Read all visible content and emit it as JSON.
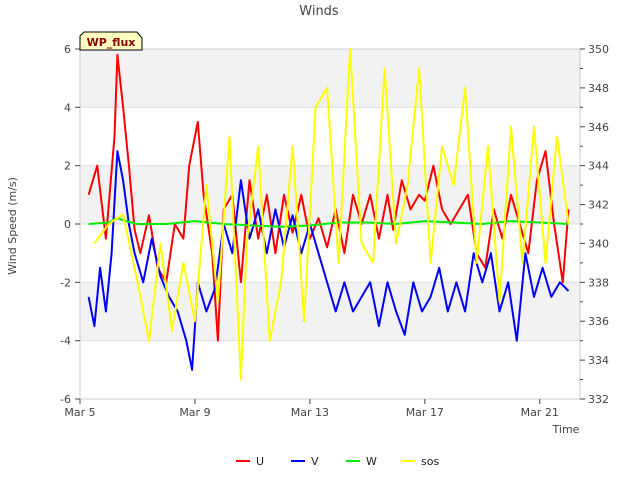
{
  "chart_data": {
    "type": "line",
    "title": "Winds",
    "xlabel": "Time",
    "ylabel": "Wind Speed (m/s)",
    "y2label": "",
    "badge": "WP_flux",
    "xlim": [
      0,
      17.4
    ],
    "ylim": [
      -6,
      6
    ],
    "y2lim": [
      332,
      350
    ],
    "x_ticks": [
      {
        "x": 0,
        "label": "Mar 5"
      },
      {
        "x": 4,
        "label": "Mar 9"
      },
      {
        "x": 8,
        "label": "Mar 13"
      },
      {
        "x": 12,
        "label": "Mar 17"
      },
      {
        "x": 16,
        "label": "Mar 21"
      }
    ],
    "y_ticks": [
      -6,
      -4,
      -2,
      0,
      2,
      4,
      6
    ],
    "y2_ticks": [
      332,
      334,
      336,
      338,
      340,
      342,
      344,
      346,
      348,
      350
    ],
    "bands": [
      [
        4,
        6
      ],
      [
        0,
        2
      ],
      [
        -4,
        -2
      ]
    ],
    "grid": true,
    "legend_position": "bottom",
    "series": [
      {
        "name": "U",
        "color": "#ff0000",
        "axis": "left",
        "x": [
          0.3,
          0.6,
          0.9,
          1.2,
          1.3,
          1.5,
          1.7,
          1.9,
          2.1,
          2.4,
          2.7,
          3.0,
          3.3,
          3.6,
          3.8,
          4.1,
          4.3,
          4.6,
          4.8,
          5.0,
          5.3,
          5.6,
          5.9,
          6.2,
          6.5,
          6.8,
          7.1,
          7.4,
          7.7,
          8.0,
          8.3,
          8.6,
          8.9,
          9.2,
          9.5,
          9.8,
          10.1,
          10.4,
          10.7,
          10.9,
          11.2,
          11.5,
          11.8,
          12.0,
          12.3,
          12.6,
          12.9,
          13.2,
          13.5,
          13.8,
          14.1,
          14.4,
          14.7,
          15.0,
          15.3,
          15.6,
          15.9,
          16.2,
          16.5,
          16.8,
          17.0
        ],
        "y": [
          1.0,
          2.0,
          -0.5,
          3.0,
          5.8,
          4.0,
          2.0,
          -0.2,
          -1.0,
          0.3,
          -1.5,
          -2.0,
          0.0,
          -0.5,
          2.0,
          3.5,
          1.0,
          -1.0,
          -4.0,
          0.5,
          1.0,
          -2.0,
          1.5,
          -0.5,
          1.0,
          -1.0,
          1.0,
          -0.3,
          1.0,
          -0.5,
          0.2,
          -0.8,
          0.5,
          -1.0,
          1.0,
          0.0,
          1.0,
          -0.5,
          1.0,
          -0.2,
          1.5,
          0.5,
          1.0,
          0.8,
          2.0,
          0.5,
          0.0,
          0.5,
          1.0,
          -1.0,
          -1.5,
          0.5,
          -0.5,
          1.0,
          0.0,
          -1.0,
          1.5,
          2.5,
          0.0,
          -2.0,
          0.5
        ]
      },
      {
        "name": "V",
        "color": "#0000ff",
        "axis": "left",
        "x": [
          0.3,
          0.5,
          0.7,
          0.9,
          1.1,
          1.3,
          1.5,
          1.7,
          1.9,
          2.2,
          2.5,
          2.8,
          3.1,
          3.4,
          3.7,
          3.9,
          4.1,
          4.4,
          4.7,
          5.0,
          5.3,
          5.6,
          5.9,
          6.2,
          6.5,
          6.8,
          7.1,
          7.4,
          7.7,
          8.0,
          8.3,
          8.6,
          8.9,
          9.2,
          9.5,
          9.8,
          10.1,
          10.4,
          10.7,
          11.0,
          11.3,
          11.6,
          11.9,
          12.2,
          12.5,
          12.8,
          13.1,
          13.4,
          13.7,
          14.0,
          14.3,
          14.6,
          14.9,
          15.2,
          15.5,
          15.8,
          16.1,
          16.4,
          16.7,
          17.0
        ],
        "y": [
          -2.5,
          -3.5,
          -1.5,
          -3.0,
          -1.0,
          2.5,
          1.5,
          0.0,
          -1.0,
          -2.0,
          -0.5,
          -1.8,
          -2.5,
          -3.0,
          -4.0,
          -5.0,
          -2.0,
          -3.0,
          -2.2,
          0.0,
          -1.0,
          1.5,
          -0.5,
          0.5,
          -1.0,
          0.5,
          -0.8,
          0.3,
          -1.0,
          0.0,
          -1.0,
          -2.0,
          -3.0,
          -2.0,
          -3.0,
          -2.5,
          -2.0,
          -3.5,
          -2.0,
          -3.0,
          -3.8,
          -2.0,
          -3.0,
          -2.5,
          -1.5,
          -3.0,
          -2.0,
          -3.0,
          -1.0,
          -2.0,
          -1.0,
          -3.0,
          -2.0,
          -4.0,
          -1.0,
          -2.5,
          -1.5,
          -2.5,
          -2.0,
          -2.3
        ]
      },
      {
        "name": "W",
        "color": "#00ee00",
        "axis": "left",
        "x": [
          0.3,
          1.0,
          1.3,
          1.6,
          2.0,
          3.0,
          4.0,
          5.0,
          6.0,
          7.0,
          8.0,
          9.0,
          10.0,
          11.0,
          12.0,
          13.0,
          14.0,
          15.0,
          16.0,
          17.0
        ],
        "y": [
          0.0,
          0.05,
          0.2,
          0.1,
          0.0,
          0.0,
          0.1,
          0.0,
          -0.05,
          -0.1,
          -0.05,
          0.05,
          0.05,
          0.0,
          0.1,
          0.05,
          0.0,
          0.1,
          0.05,
          0.0
        ]
      },
      {
        "name": "sos",
        "color": "#ffff00",
        "axis": "right",
        "x": [
          0.5,
          1.0,
          1.5,
          2.0,
          2.4,
          2.8,
          3.2,
          3.6,
          4.0,
          4.4,
          4.8,
          5.2,
          5.6,
          5.8,
          6.2,
          6.6,
          7.0,
          7.4,
          7.8,
          8.2,
          8.6,
          9.0,
          9.4,
          9.8,
          10.2,
          10.6,
          11.0,
          11.4,
          11.8,
          12.2,
          12.6,
          13.0,
          13.4,
          13.8,
          14.2,
          14.6,
          15.0,
          15.4,
          15.8,
          16.2,
          16.6,
          17.0
        ],
        "y": [
          340,
          341,
          341.5,
          338,
          335,
          340,
          335.5,
          339,
          336,
          343,
          337,
          345.5,
          333,
          340,
          345,
          335,
          338,
          345,
          336,
          347,
          348,
          339,
          350,
          340,
          339,
          349,
          340,
          343,
          349,
          339,
          345,
          343,
          348,
          339,
          345,
          337,
          346,
          339,
          346,
          339,
          345.5,
          341
        ]
      }
    ],
    "legend": [
      "U",
      "V",
      "W",
      "sos"
    ]
  }
}
